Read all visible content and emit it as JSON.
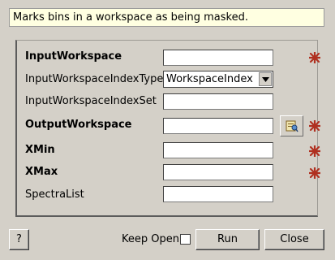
{
  "description": "Marks bins in a workspace as being masked.",
  "properties": [
    {
      "label": "InputWorkspace",
      "value": ""
    },
    {
      "label": "InputWorkspaceIndexType",
      "value": "WorkspaceIndex"
    },
    {
      "label": "InputWorkspaceIndexSet",
      "value": ""
    },
    {
      "label": "OutputWorkspace",
      "value": ""
    },
    {
      "label": "XMin",
      "value": ""
    },
    {
      "label": "XMax",
      "value": ""
    },
    {
      "label": "SpectraList",
      "value": ""
    }
  ],
  "buttons": {
    "help": "?",
    "keep_open": "Keep Open",
    "run": "Run",
    "close": "Close"
  },
  "keep_open_checked": false,
  "colors": {
    "background": "#d4d0c8",
    "description_background": "#ffffe1",
    "required_marker": "#b03020"
  },
  "icons": {
    "required": "required-star-icon",
    "browse": "workspace-browse-icon",
    "dropdown": "chevron-down-icon"
  }
}
